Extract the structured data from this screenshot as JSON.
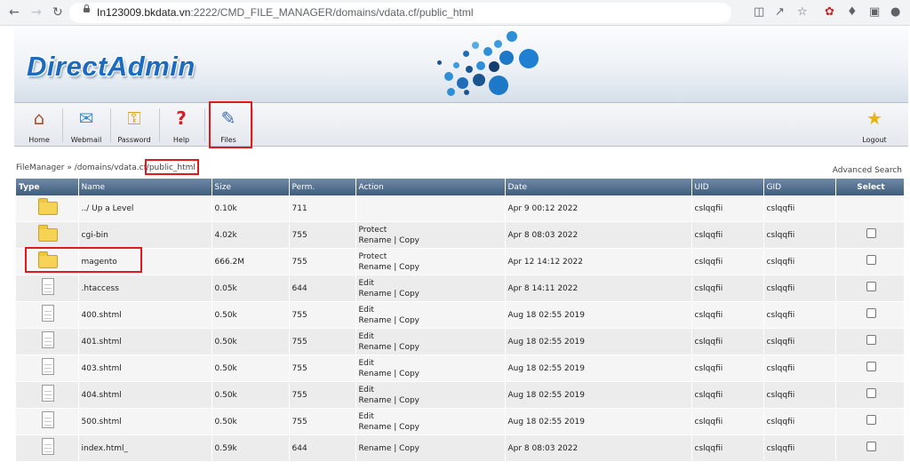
{
  "browser": {
    "url_host": "In123009.bkdata.vn",
    "url_path": ":2222/CMD_FILE_MANAGER/domains/vdata.cf/public_html"
  },
  "app": {
    "logo": "DirectAdmin",
    "colors": {
      "brand": "#1c6bbf",
      "header_bg": "#3f5d7d",
      "highlight": "#e0191d"
    }
  },
  "toolbar": {
    "items": [
      {
        "label": "Home",
        "icon": "house-icon"
      },
      {
        "label": "Webmail",
        "icon": "mail-icon"
      },
      {
        "label": "Password",
        "icon": "lock-icon"
      },
      {
        "label": "Help",
        "icon": "question-icon"
      },
      {
        "label": "Files",
        "icon": "files-icon"
      }
    ],
    "logout": {
      "label": "Logout",
      "icon": "star-icon"
    }
  },
  "breadcrumb": {
    "prefix": "FileManager » /domains/vdata.cf/",
    "current": "public_html"
  },
  "advanced_search": "Advanced Search",
  "table": {
    "columns": [
      "Type",
      "Name",
      "Size",
      "Perm.",
      "Action",
      "Date",
      "UID",
      "GID",
      "Select"
    ],
    "rows": [
      {
        "type": "folder",
        "name": "../ Up a Level",
        "size": "0.10k",
        "perm": "711",
        "action1": "",
        "action2": "",
        "date": "Apr 9 00:12 2022",
        "uid": "cslqqfii",
        "gid": "cslqqfii",
        "select": false
      },
      {
        "type": "folder",
        "name": "cgi-bin",
        "size": "4.02k",
        "perm": "755",
        "action1": "Protect",
        "action2": "Rename | Copy",
        "date": "Apr 8 08:03 2022",
        "uid": "cslqqfii",
        "gid": "cslqqfii",
        "select": true
      },
      {
        "type": "folder",
        "name": "magento",
        "size": "666.2M",
        "perm": "755",
        "action1": "Protect",
        "action2": "Rename | Copy",
        "date": "Apr 12 14:12 2022",
        "uid": "cslqqfii",
        "gid": "cslqqfii",
        "select": true
      },
      {
        "type": "file",
        "name": ".htaccess",
        "size": "0.05k",
        "perm": "644",
        "action1": "Edit",
        "action2": "Rename | Copy",
        "date": "Apr 8 14:11 2022",
        "uid": "cslqqfii",
        "gid": "cslqqfii",
        "select": true
      },
      {
        "type": "file",
        "name": "400.shtml",
        "size": "0.50k",
        "perm": "755",
        "action1": "Edit",
        "action2": "Rename | Copy",
        "date": "Aug 18 02:55 2019",
        "uid": "cslqqfii",
        "gid": "cslqqfii",
        "select": true
      },
      {
        "type": "file",
        "name": "401.shtml",
        "size": "0.50k",
        "perm": "755",
        "action1": "Edit",
        "action2": "Rename | Copy",
        "date": "Aug 18 02:55 2019",
        "uid": "cslqqfii",
        "gid": "cslqqfii",
        "select": true
      },
      {
        "type": "file",
        "name": "403.shtml",
        "size": "0.50k",
        "perm": "755",
        "action1": "Edit",
        "action2": "Rename | Copy",
        "date": "Aug 18 02:55 2019",
        "uid": "cslqqfii",
        "gid": "cslqqfii",
        "select": true
      },
      {
        "type": "file",
        "name": "404.shtml",
        "size": "0.50k",
        "perm": "755",
        "action1": "Edit",
        "action2": "Rename | Copy",
        "date": "Aug 18 02:55 2019",
        "uid": "cslqqfii",
        "gid": "cslqqfii",
        "select": true
      },
      {
        "type": "file",
        "name": "500.shtml",
        "size": "0.50k",
        "perm": "755",
        "action1": "Edit",
        "action2": "Rename | Copy",
        "date": "Aug 18 02:55 2019",
        "uid": "cslqqfii",
        "gid": "cslqqfii",
        "select": true
      },
      {
        "type": "file",
        "name": "index.html_",
        "size": "0.59k",
        "perm": "644",
        "action1": "",
        "action2": "Rename | Copy",
        "date": "Apr 8 08:03 2022",
        "uid": "cslqqfii",
        "gid": "cslqqfii",
        "select": true
      }
    ]
  }
}
